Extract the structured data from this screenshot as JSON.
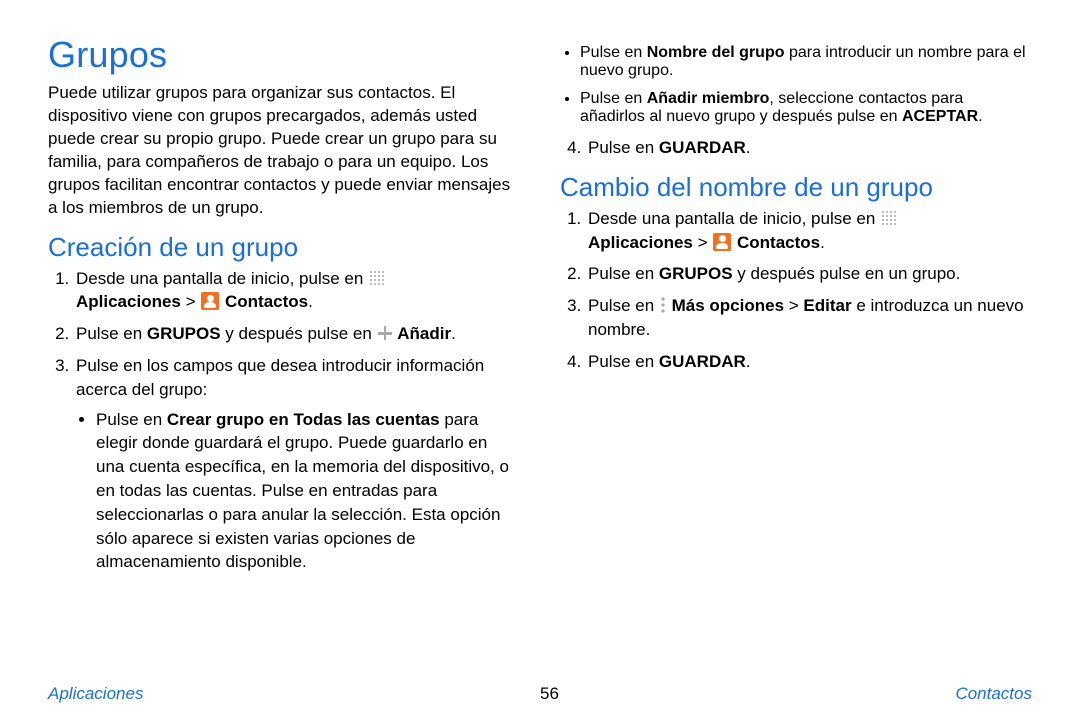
{
  "title": "Grupos",
  "intro": "Puede utilizar grupos para organizar sus contactos. El dispositivo viene con grupos precargados, además usted puede crear su propio grupo. Puede crear un grupo para su familia, para compañeros de trabajo o para un equipo. Los grupos facilitan encontrar contactos y puede enviar mensajes a los miembros de un grupo.",
  "section_create": {
    "heading": "Creación de un grupo",
    "step1_a": "Desde una pantalla de inicio, pulse en ",
    "step1_break": " ",
    "step1_apps": "Aplicaciones",
    "step1_gt": " > ",
    "step1_contacts": "Contactos",
    "period": ".",
    "step2_a": "Pulse en ",
    "step2_grupos": "GRUPOS",
    "step2_b": " y después pulse en ",
    "step2_add": "Añadir",
    "step3": "Pulse en los campos que desea introducir información acerca del grupo:",
    "sub1_a": "Pulse en ",
    "sub1_bold": "Crear grupo en Todas las cuentas",
    "sub1_b": " para elegir donde guardará el grupo. Puede guardarlo en una cuenta específica, en la memoria del dispositivo, o en todas las cuentas. Pulse en entradas para seleccionarlas o para anular la selección. Esta opción sólo aparece si existen varias opciones de almacenamiento disponible.",
    "sub2_a": "Pulse en ",
    "sub2_bold": "Nombre del grupo",
    "sub2_b": " para introducir un nombre para el nuevo grupo.",
    "sub3_a": "Pulse en ",
    "sub3_bold": "Añadir miembro",
    "sub3_b": ", seleccione contactos para añadirlos al nuevo grupo y después pulse en ",
    "sub3_accept": "ACEPTAR",
    "step4_a": "Pulse en ",
    "step4_save": "GUARDAR"
  },
  "section_rename": {
    "heading": "Cambio del nombre de un grupo",
    "step1_a": "Desde una pantalla de inicio, pulse en ",
    "step1_apps": "Aplicaciones",
    "step1_gt": " > ",
    "step1_contacts": "Contactos",
    "step2_a": "Pulse en ",
    "step2_grupos": "GRUPOS",
    "step2_b": " y después pulse en un grupo.",
    "step3_a": "Pulse en ",
    "step3_more": "Más opciones",
    "step3_gt": " > ",
    "step3_edit": "Editar",
    "step3_b": " e introduzca un nuevo nombre.",
    "step4_a": "Pulse en ",
    "step4_save": "GUARDAR"
  },
  "footer": {
    "left": "Aplicaciones",
    "center": "56",
    "right": "Contactos"
  }
}
